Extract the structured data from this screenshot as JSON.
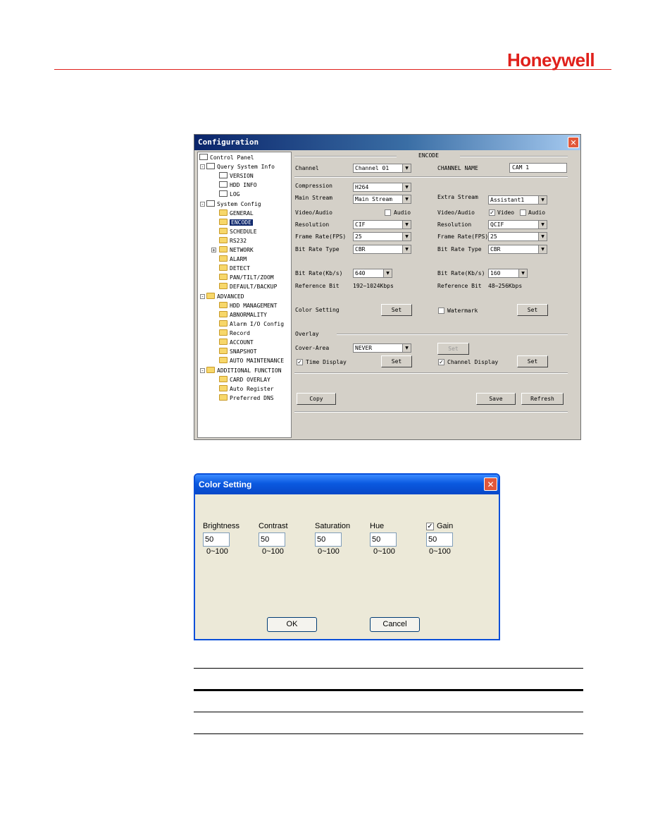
{
  "header": {
    "logo": "Honeywell",
    "accent": "#e0201b"
  },
  "config": {
    "title": "Configuration",
    "tree": {
      "control_panel": "Control Panel",
      "query": "Query System Info",
      "version": "VERSION",
      "hdd_info": "HDD INFO",
      "log": "LOG",
      "system_config": "System Config",
      "general": "GENERAL",
      "encode": "ENCODE",
      "schedule": "SCHEDULE",
      "rs232": "RS232",
      "network": "NETWORK",
      "alarm": "ALARM",
      "detect": "DETECT",
      "ptz": "PAN/TILT/ZOOM",
      "default": "DEFAULT/BACKUP",
      "advanced": "ADVANCED",
      "hdd_mgmt": "HDD MANAGEMENT",
      "abnormality": "ABNORMALITY",
      "alarm_io": "Alarm I/O Config",
      "record": "Record",
      "account": "ACCOUNT",
      "snapshot": "SNAPSHOT",
      "auto_maint": "AUTO MAINTENANCE",
      "additional": "ADDITIONAL FUNCTION",
      "card_overlay": "CARD OVERLAY",
      "auto_register": "Auto Register",
      "preferred_dns": "Preferred DNS"
    },
    "encode": {
      "section": "ENCODE",
      "channel_label": "Channel",
      "channel_value": "Channel 01",
      "channel_name_label": "CHANNEL NAME",
      "channel_name_value": "CAM 1",
      "compression_label": "Compression",
      "compression_value": "H264",
      "main_stream_label": "Main Stream",
      "main_stream_value": "Main Stream",
      "extra_stream_label": "Extra Stream",
      "extra_stream_value": "Assistant1",
      "va_label": "Video/Audio",
      "audio": "Audio",
      "video": "Video",
      "resolution_label": "Resolution",
      "res_main": "CIF",
      "res_extra": "QCIF",
      "fps_label": "Frame Rate(FPS)",
      "fps_main": "25",
      "fps_extra": "25",
      "brt_label": "Bit Rate Type",
      "brt_main": "CBR",
      "brt_extra": "CBR",
      "br_label": "Bit Rate(Kb/s)",
      "br_main": "640",
      "br_extra": "160",
      "ref_label": "Reference Bit",
      "ref_main": "192~1024Kbps",
      "ref_extra": "48~256Kbps",
      "color_label": "Color Setting",
      "set": "Set",
      "watermark": "Watermark",
      "overlay": "Overlay",
      "cover_label": "Cover-Area",
      "cover_value": "NEVER",
      "time_display": "Time Display",
      "channel_display": "Channel Display",
      "copy": "Copy",
      "save": "Save",
      "refresh": "Refresh"
    }
  },
  "color": {
    "title": "Color Setting",
    "brightness": "Brightness",
    "contrast": "Contrast",
    "saturation": "Saturation",
    "hue": "Hue",
    "gain": "Gain",
    "brightness_value": "50",
    "contrast_value": "50",
    "saturation_value": "50",
    "hue_value": "50",
    "gain_value": "50",
    "range": "0~100",
    "ok": "OK",
    "cancel": "Cancel"
  }
}
